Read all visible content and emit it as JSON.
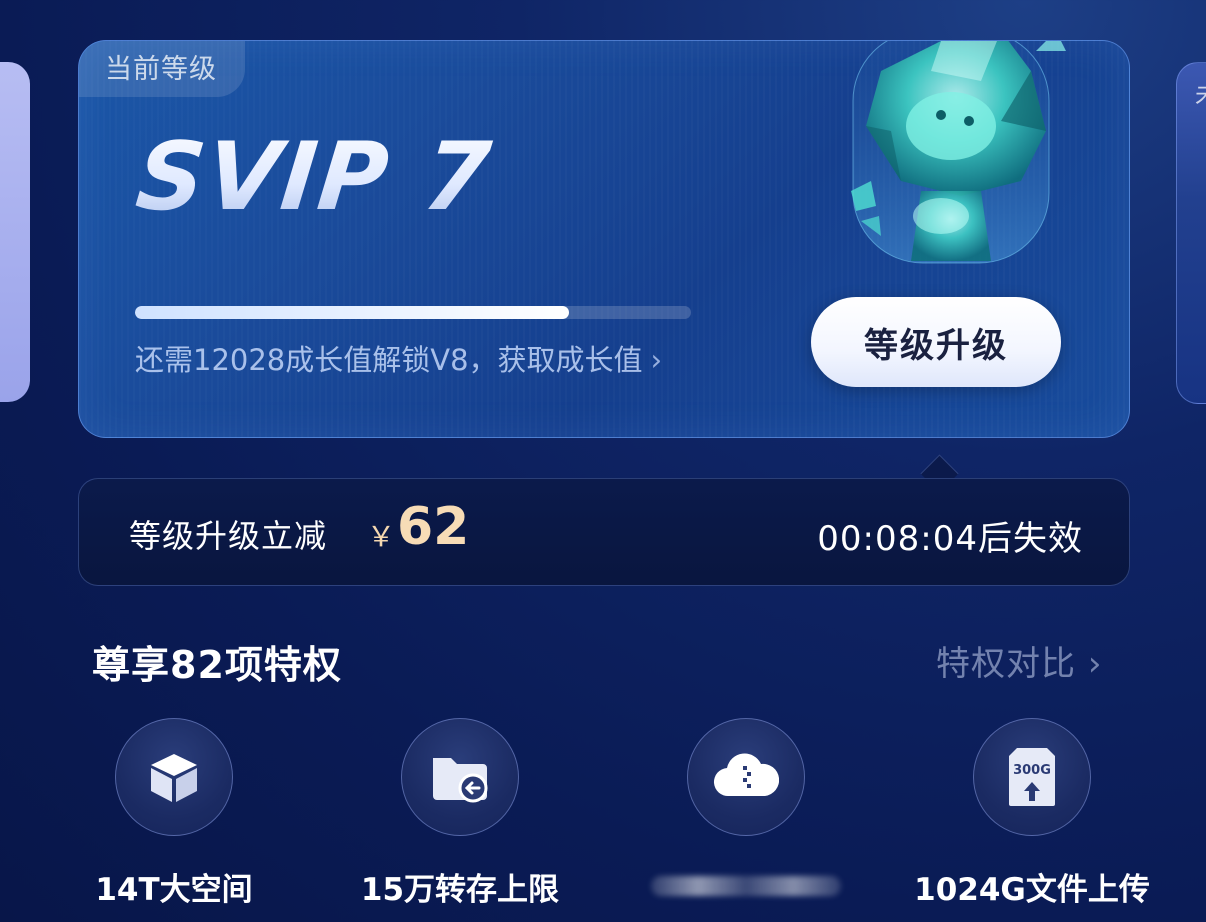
{
  "level_card": {
    "tag": "当前等级",
    "level_name": "SVIP 7",
    "progress_fraction": 0.78,
    "progress_text": "还需12028成长值解锁V8，获取成长值",
    "upgrade_label": "等级升级"
  },
  "discount": {
    "label": "等级升级立减",
    "currency": "￥",
    "amount": "62",
    "countdown": "00:08:04后失效"
  },
  "privileges": {
    "title": "尊享82项特权",
    "compare_label": "特权对比",
    "items": [
      {
        "icon": "cube-icon",
        "label": "14T大空间"
      },
      {
        "icon": "folder-transfer-icon",
        "label": "15万转存上限"
      },
      {
        "icon": "cloud-zip-icon",
        "label": ""
      },
      {
        "icon": "upload-300g-icon",
        "label": "1024G文件上传",
        "icon_text": "300G"
      }
    ]
  },
  "side_card_right": {
    "tag": "未"
  },
  "colors": {
    "background": "#0a1b55",
    "card": "#1a4b9b",
    "accent_price": "#f7dcb6",
    "button_text": "#1a2140"
  }
}
